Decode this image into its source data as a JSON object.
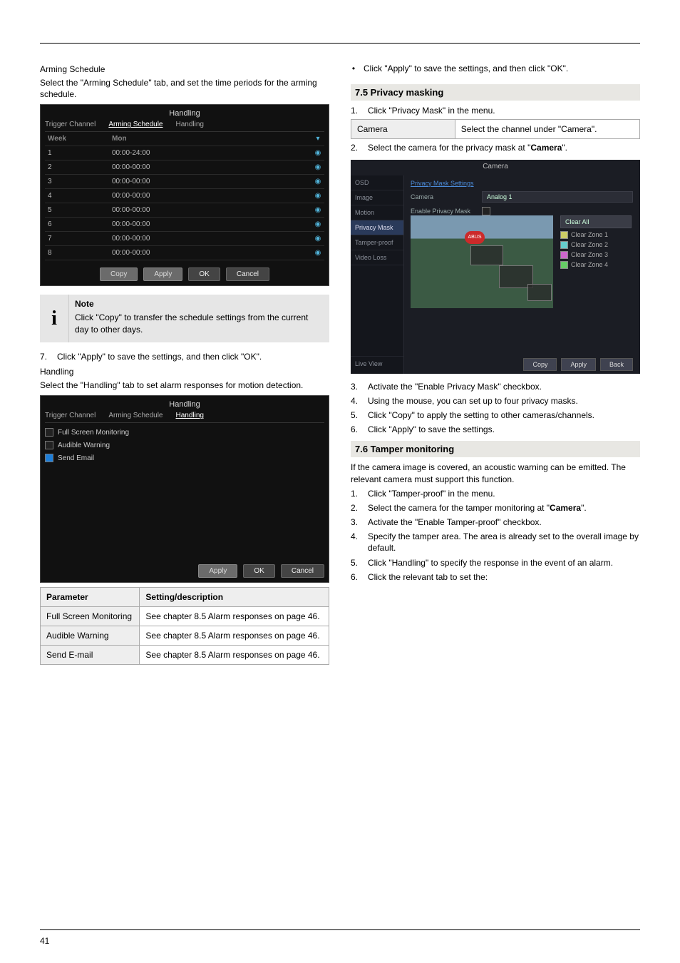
{
  "footer_page": "41",
  "left": {
    "label_arming": "Arming Schedule",
    "para_arming": "Select the \"Arming Schedule\" tab, and set the time periods for the arming schedule.",
    "fig1": {
      "title": "Handling",
      "tabs": {
        "trigger": "Trigger Channel",
        "arming": "Arming Schedule",
        "handling": "Handling"
      },
      "head": {
        "week": "Week",
        "day": "Mon"
      },
      "rows": [
        {
          "i": "1",
          "t": "00:00-24:00"
        },
        {
          "i": "2",
          "t": "00:00-00:00"
        },
        {
          "i": "3",
          "t": "00:00-00:00"
        },
        {
          "i": "4",
          "t": "00:00-00:00"
        },
        {
          "i": "5",
          "t": "00:00-00:00"
        },
        {
          "i": "6",
          "t": "00:00-00:00"
        },
        {
          "i": "7",
          "t": "00:00-00:00"
        },
        {
          "i": "8",
          "t": "00:00-00:00"
        }
      ],
      "buttons": {
        "copy": "Copy",
        "apply": "Apply",
        "ok": "OK",
        "cancel": "Cancel"
      }
    },
    "note": {
      "title": "Note",
      "body": "Click \"Copy\" to transfer the schedule settings from the current day to other days."
    },
    "step7_n": "7.",
    "step7": "Click \"Apply\" to save the settings, and then click \"OK\".",
    "label_handling": "Handling",
    "para_handling": "Select the \"Handling\" tab to set alarm responses for motion detection.",
    "fig2": {
      "title": "Handling",
      "tabs": {
        "trigger": "Trigger Channel",
        "arming": "Arming Schedule",
        "handling": "Handling"
      },
      "rows": [
        {
          "label": "Full Screen Monitoring",
          "checked": false
        },
        {
          "label": "Audible Warning",
          "checked": false
        },
        {
          "label": "Send Email",
          "checked": true
        }
      ],
      "buttons": {
        "apply": "Apply",
        "ok": "OK",
        "cancel": "Cancel"
      }
    },
    "table": {
      "head": {
        "c1": "Parameter",
        "c2": "Setting/description"
      },
      "rows": [
        {
          "c1": "Full Screen Monitoring",
          "c2": "See chapter 8.5 Alarm responses on page 46."
        },
        {
          "c1": "Audible Warning",
          "c2": "See chapter 8.5 Alarm responses on page 46."
        },
        {
          "c1": "Send E-mail",
          "c2": "See chapter 8.5 Alarm responses on page 46."
        }
      ]
    }
  },
  "right": {
    "bullet": "Click \"Apply\" to save the settings, and then click \"OK\".",
    "heading_privacy": "7.5 Privacy masking",
    "step1_n": "1.",
    "step1": "Click \"Privacy Mask\" in the menu.",
    "camera_dropdown_label": "Camera",
    "camera_dropdown_note": "Select the channel under \"Camera\".",
    "step2_n": "2.",
    "step2_a": "Select the camera for the privacy mask at \"",
    "step2_b": "\".",
    "fig3": {
      "title": "Camera",
      "side": {
        "osd": "OSD",
        "image": "Image",
        "motion": "Motion",
        "privacy": "Privacy Mask",
        "tamper": "Tamper-proof",
        "video": "Video Loss",
        "live": "Live View"
      },
      "link": "Privacy Mask Settings",
      "row1": {
        "lab": "Camera",
        "val": "Analog 1"
      },
      "row2": {
        "lab": "Enable Privacy Mask",
        "val": ""
      },
      "logo": "ABUS",
      "zones": {
        "clear_all": "Clear All",
        "z1": "Clear Zone 1",
        "z2": "Clear Zone 2",
        "z3": "Clear Zone 3",
        "z4": "Clear Zone 4"
      },
      "buttons": {
        "copy": "Copy",
        "apply": "Apply",
        "back": "Back"
      }
    },
    "step3_n": "3.",
    "step3": "Activate the \"Enable Privacy Mask\" checkbox.",
    "step4_n": "4.",
    "step4": "Using the mouse, you can set up to four privacy masks.",
    "step5_n": "5.",
    "step5": "Click \"Copy\" to apply the setting to other cameras/channels.",
    "step6_n": "6.",
    "step6": "Click \"Apply\" to save the settings.",
    "heading_tamper": "7.6 Tamper monitoring",
    "tamper_para": "If the camera image is covered, an acoustic warning can be emitted. The relevant camera must support this function.",
    "t1_n": "1.",
    "t1": "Click \"Tamper-proof\" in the menu.",
    "t2_n": "2.",
    "t2a": "Select the camera for the tamper monitoring at \"",
    "t2b": "Camera",
    "t2c": "\".",
    "t3_n": "3.",
    "t3": "Activate the \"Enable Tamper-proof\" checkbox.",
    "t4_n": "4.",
    "t4": "Specify the tamper area. The area is already set to the overall image by default.",
    "t5_n": "5.",
    "t5": "Click \"Handling\" to specify the response in the event of an alarm.",
    "t6_n": "6.",
    "t6": "Click the relevant tab to set the:"
  }
}
